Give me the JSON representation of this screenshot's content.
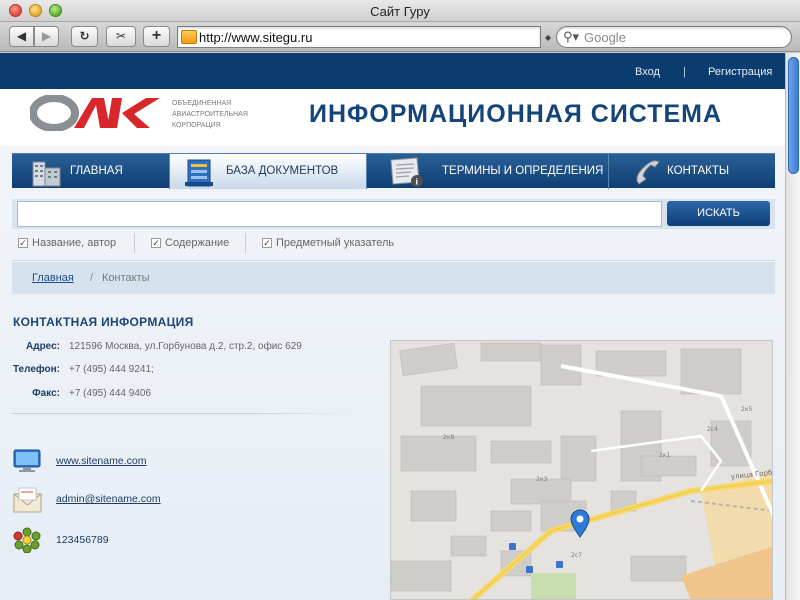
{
  "window": {
    "title": "Сайт Гуру"
  },
  "browser": {
    "url": "http://www.sitegu.ru",
    "search_placeholder": "Google"
  },
  "topbar": {
    "login": "Вход",
    "separator": "|",
    "register": "Регистрация"
  },
  "header": {
    "logo_text": "ОАК",
    "logo_caption": [
      "ОБЪЕДИНЕННАЯ",
      "АВИАСТРОИТЕЛЬНАЯ",
      "КОРПОРАЦИЯ"
    ],
    "system_title": "ИНФОРМАЦИОННАЯ СИСТЕМА"
  },
  "nav": {
    "items": [
      {
        "label": "ГЛАВНАЯ",
        "icon": "buildings-icon",
        "active": false
      },
      {
        "label": "БАЗА ДОКУМЕНТОВ",
        "icon": "document-base-icon",
        "active": true
      },
      {
        "label": "ТЕРМИНЫ И ОПРЕДЕЛЕНИЯ",
        "icon": "terms-info-icon",
        "active": false
      },
      {
        "label": "КОНТАКТЫ",
        "icon": "phone-icon",
        "active": false
      }
    ]
  },
  "search": {
    "value": "",
    "button": "ИСКАТЬ",
    "options": [
      {
        "label": "Название, автор",
        "checked": true
      },
      {
        "label": "Содержание",
        "checked": true
      },
      {
        "label": "Предметный указатель",
        "checked": true
      }
    ]
  },
  "breadcrumb": {
    "home": "Главная",
    "separator": "/",
    "current": "Контакты"
  },
  "contacts": {
    "title": "КОНТАКТНАЯ ИНФОРМАЦИЯ",
    "address_label": "Адрес:",
    "address": "121596 Москва, ул.Горбунова д.2, стр.2, офис 629",
    "phone_label": "Телефон:",
    "phone": "+7 (495) 444 9241;",
    "fax_label": "Факс:",
    "fax": "+7 (495) 444 9406",
    "website": "www.sitename.com",
    "email": "admin@sitename.com",
    "icq": "123456789"
  },
  "map": {
    "street_label": "улица Горбу",
    "house_labels": [
      "2к8",
      "2к1",
      "2к3",
      "2с4",
      "2с7",
      "2к5"
    ]
  },
  "colors": {
    "brand_dark": "#0b3c70",
    "title_blue": "#13447a",
    "logo_red": "#d9262b",
    "logo_grey": "#8a8f95"
  }
}
